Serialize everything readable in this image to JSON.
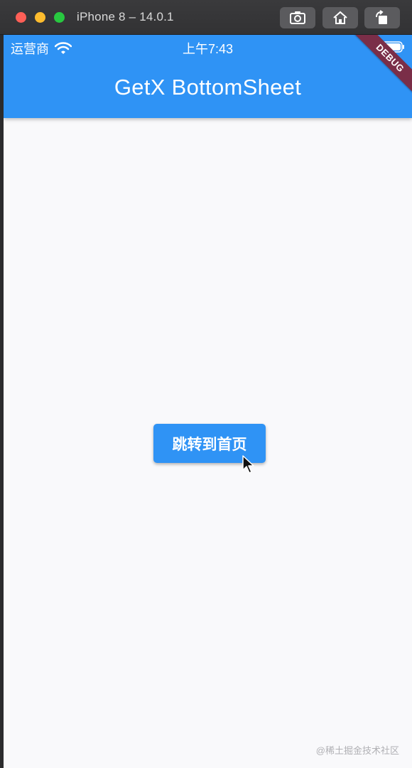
{
  "window": {
    "title": "iPhone 8 – 14.0.1",
    "toolbar": {
      "screenshot_icon": "camera-icon",
      "home_icon": "home-icon",
      "rotate_icon": "rotate-icon"
    }
  },
  "status_bar": {
    "carrier": "运营商",
    "time": "上午7:43",
    "wifi_icon": "wifi-icon",
    "battery_icon": "battery-icon"
  },
  "app_bar": {
    "title": "GetX BottomSheet",
    "debug_label": "DEBUG"
  },
  "main": {
    "button_label": "跳转到首页"
  },
  "watermark": "@稀土掘金技术社区",
  "colors": {
    "primary": "#2f93f5",
    "background": "#f9f9fb",
    "debug_banner": "#7a2e48"
  }
}
